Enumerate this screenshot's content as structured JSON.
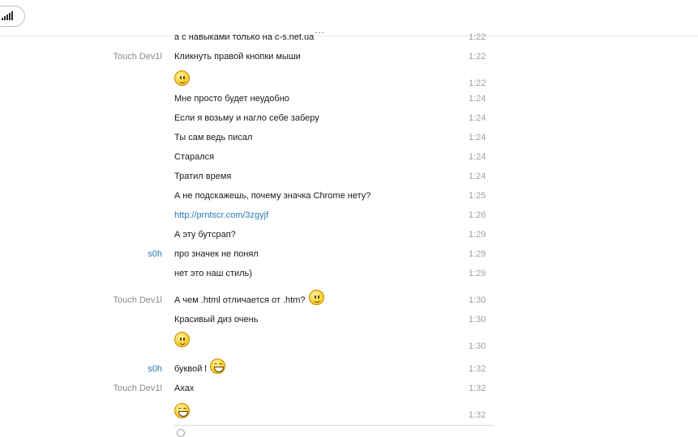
{
  "more_indicator": "...",
  "messages": [
    {
      "sender": "",
      "me": false,
      "text": "а с навыками только на c-s.net.ua",
      "time": "1:22",
      "emoji": null
    },
    {
      "sender": "Touch Dev1l",
      "me": false,
      "text": "Кликнуть правой кнопки мыши",
      "time": "1:22",
      "emoji": null
    },
    {
      "sender": "",
      "me": false,
      "text": "",
      "time": "1:22",
      "emoji": "smile-icon"
    },
    {
      "sender": "",
      "me": false,
      "text": "Мне просто будет неудобно",
      "time": "1:24",
      "emoji": null
    },
    {
      "sender": "",
      "me": false,
      "text": "Если я возьму и нагло себе заберу",
      "time": "1:24",
      "emoji": null
    },
    {
      "sender": "",
      "me": false,
      "text": "Ты сам ведь писал",
      "time": "1:24",
      "emoji": null
    },
    {
      "sender": "",
      "me": false,
      "text": "Старался",
      "time": "1:24",
      "emoji": null
    },
    {
      "sender": "",
      "me": false,
      "text": "Тратил время",
      "time": "1:24",
      "emoji": null
    },
    {
      "sender": "",
      "me": false,
      "text": "А не подскажешь, почему значка Chrome нету?",
      "time": "1:25",
      "emoji": null
    },
    {
      "sender": "",
      "me": false,
      "text": "http://prntscr.com/3zgyjf",
      "time": "1:26",
      "emoji": null,
      "link": true
    },
    {
      "sender": "",
      "me": false,
      "text": "А эту бутсрап?",
      "time": "1:29",
      "emoji": null
    },
    {
      "sender": "s0h",
      "me": true,
      "text": "про значек не понял",
      "time": "1:29",
      "emoji": null
    },
    {
      "sender": "",
      "me": true,
      "text": "нет это наш стиль)",
      "time": "1:29",
      "emoji": null
    },
    {
      "sender": "Touch Dev1l",
      "me": false,
      "text": "А чем .html отличается от .htm?",
      "time": "1:30",
      "emoji": "smile-icon"
    },
    {
      "sender": "",
      "me": false,
      "text": "Красивый диз очень",
      "time": "1:30",
      "emoji": null
    },
    {
      "sender": "",
      "me": false,
      "text": "",
      "time": "1:30",
      "emoji": "smile-icon"
    },
    {
      "sender": "s0h",
      "me": true,
      "text": "буквой l",
      "time": "1:32",
      "emoji": "grin-icon"
    },
    {
      "sender": "Touch Dev1l",
      "me": false,
      "text": "Ахах",
      "time": "1:32",
      "emoji": null
    },
    {
      "sender": "",
      "me": false,
      "text": "",
      "time": "1:32",
      "emoji": "grin-icon"
    }
  ]
}
